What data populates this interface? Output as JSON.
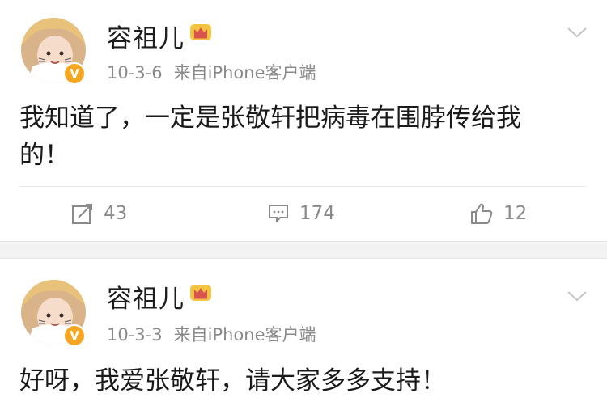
{
  "posts": [
    {
      "author": "容祖儿",
      "date": "10-3-6",
      "source": "来自iPhone客户端",
      "content_line1": "我知道了，一定是张敬轩把病毒在围脖传给我",
      "content_line2": "的！",
      "reposts": "43",
      "comments": "174",
      "likes": "12",
      "verified_badge": "V"
    },
    {
      "author": "容祖儿",
      "date": "10-3-3",
      "source": "来自iPhone客户端",
      "content_line1": "好呀，我爱张敬轩，请大家多多支持！",
      "verified_badge": "V"
    }
  ],
  "colors": {
    "accent_badge": "#f5a623",
    "meta_text": "#8a8a8a",
    "separator": "#f2f2f2"
  },
  "icons": {
    "repost": "repost-icon",
    "comment": "comment-icon",
    "like": "thumbs-up-icon",
    "more": "chevron-down-icon",
    "crown": "crown-icon"
  }
}
